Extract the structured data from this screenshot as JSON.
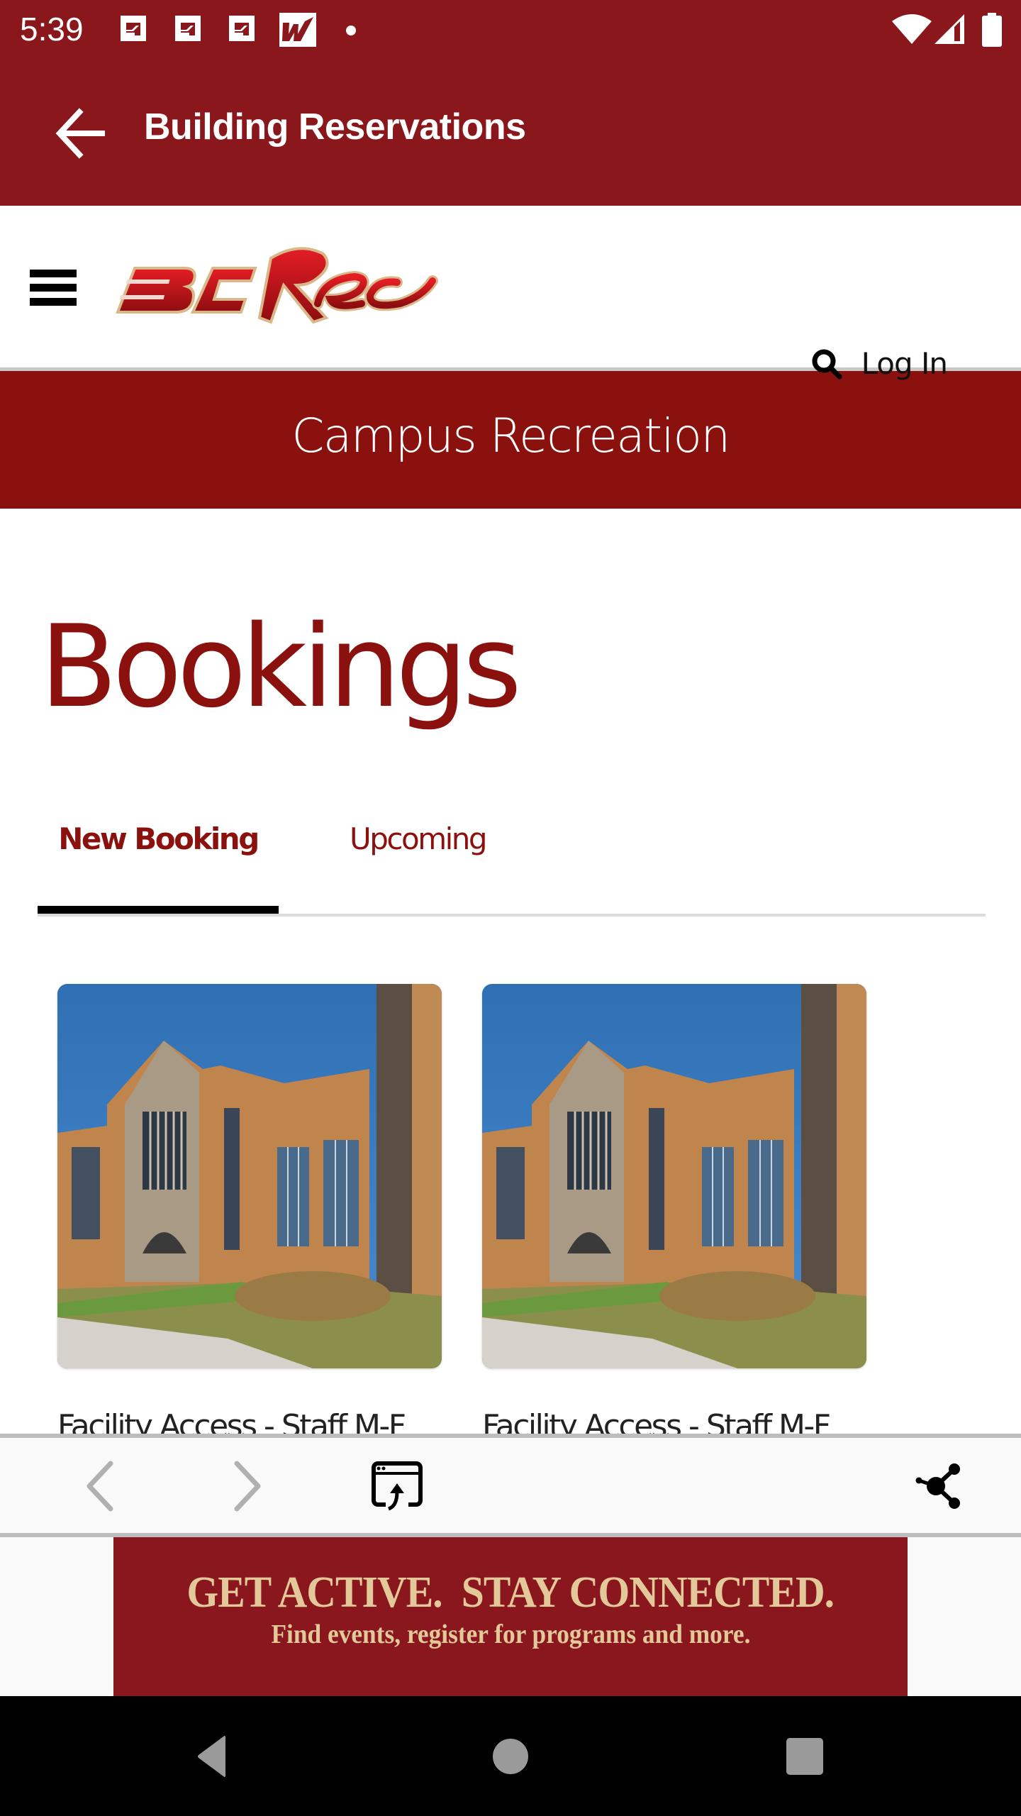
{
  "status_bar": {
    "time": "5:39",
    "notification_icons": [
      "flashscore-app-icon",
      "flashscore-app-icon",
      "flashscore-app-icon",
      "w-sports-app-icon",
      "more-notifications-dot"
    ],
    "system_icons": [
      "wifi-icon",
      "cell-signal-icon",
      "battery-icon"
    ]
  },
  "app_bar": {
    "title": "Building Reservations",
    "back_icon": "arrow-left-icon"
  },
  "site_header": {
    "logo_text": "BCRec",
    "menu_icon": "hamburger-icon",
    "search_icon": "search-icon",
    "login_label": "Log In"
  },
  "campus_band": {
    "title": "Campus Recreation"
  },
  "page": {
    "title": "Bookings"
  },
  "tabs": [
    {
      "label": "New Booking",
      "active": true
    },
    {
      "label": "Upcoming",
      "active": false
    }
  ],
  "cards": [
    {
      "label": "Facility Access - Staff M-F",
      "image": "building-photo"
    },
    {
      "label": "Facility Access - Staff M-F",
      "image": "building-photo"
    }
  ],
  "browser_toolbar": {
    "back_icon": "chevron-left-icon",
    "forward_icon": "chevron-right-icon",
    "open_in_browser_icon": "open-in-browser-icon",
    "share_icon": "share-icon"
  },
  "banner": {
    "headline": "GET ACTIVE.  STAY CONNECTED.",
    "subline": "Find events, register for programs and more."
  },
  "nav_bar": {
    "back_icon": "nav-back-icon",
    "home_icon": "nav-home-icon",
    "recents_icon": "nav-recents-icon"
  },
  "colors": {
    "brand_red": "#8a171b",
    "heading_red": "#8a110d",
    "banner_gold": "#e3c99a",
    "tab_indicator": "#000000"
  }
}
